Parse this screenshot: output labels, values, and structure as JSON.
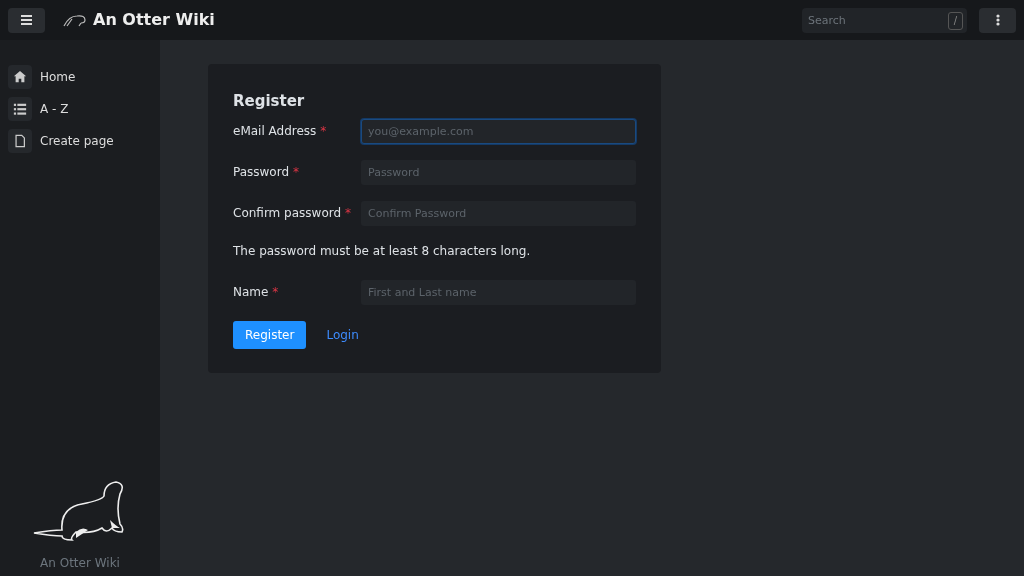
{
  "navbar": {
    "title": "An Otter Wiki",
    "search": {
      "placeholder": "Search",
      "shortcut": "/"
    }
  },
  "sidebar": {
    "items": [
      {
        "label": "Home",
        "kind": "home"
      },
      {
        "label": "A - Z",
        "kind": "list"
      },
      {
        "label": "Create page",
        "kind": "file"
      }
    ],
    "footer": "An Otter Wiki"
  },
  "form": {
    "title": "Register",
    "fields": [
      {
        "kind": "field",
        "label": "eMail Address",
        "required_mark": "*",
        "placeholder": "you@example.com",
        "focused": true
      },
      {
        "kind": "field",
        "label": "Password",
        "required_mark": "*",
        "placeholder": "Password",
        "focused": false
      },
      {
        "kind": "field",
        "label": "Confirm password",
        "required_mark": "*",
        "placeholder": "Confirm Password",
        "focused": false
      },
      {
        "kind": "note",
        "text": "The password must be at least 8 characters long."
      },
      {
        "kind": "field",
        "label": "Name",
        "required_mark": "*",
        "placeholder": "First and Last name",
        "focused": false
      }
    ],
    "submit": "Register",
    "link": "Login"
  }
}
